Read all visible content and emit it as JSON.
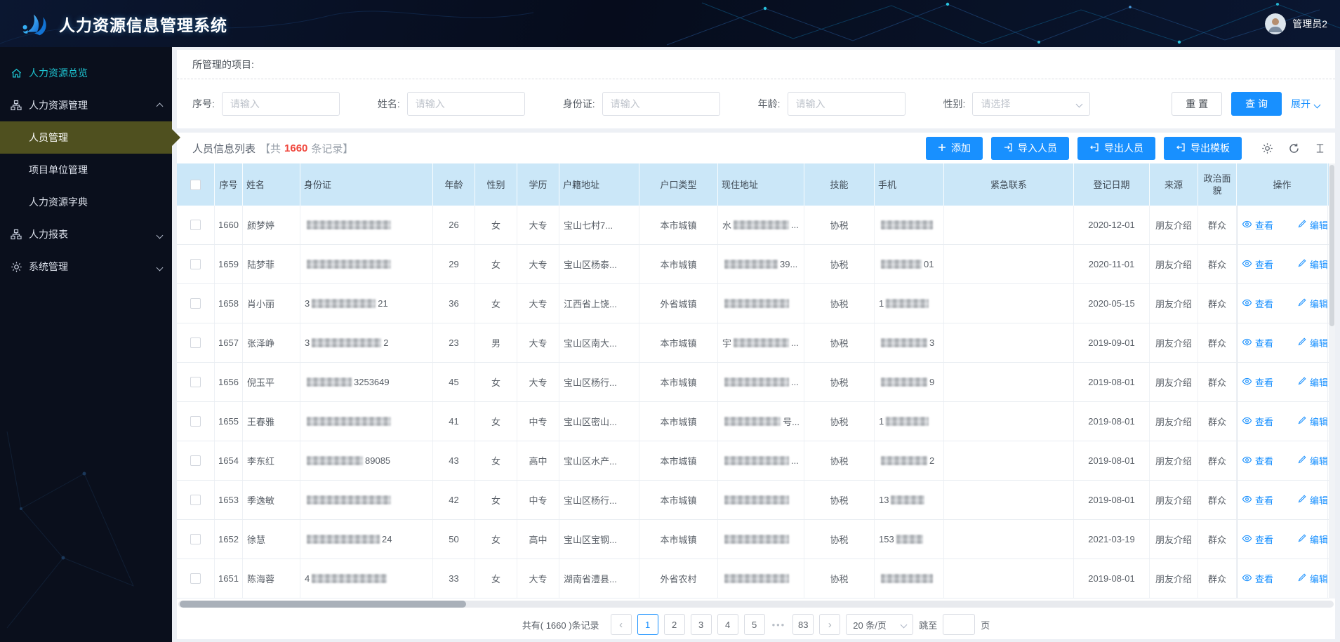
{
  "app": {
    "title": "人力资源信息管理系统",
    "user": "管理员2"
  },
  "colors": {
    "primary": "#1890ff",
    "accent_cyan": "#1ec6d3",
    "count_red": "#f0463c",
    "table_header_bg": "#cbe7f8",
    "active_menu": "#4f501f"
  },
  "sidebar": {
    "items": [
      {
        "id": "hr-overview",
        "label": "人力资源总览",
        "icon": "home",
        "type": "top",
        "accent": true
      },
      {
        "id": "hr-management",
        "label": "人力资源管理",
        "icon": "sitemap",
        "type": "top",
        "expanded": true
      },
      {
        "id": "personnel-management",
        "label": "人员管理",
        "type": "sub",
        "active": true
      },
      {
        "id": "project-unit-management",
        "label": "项目单位管理",
        "type": "sub"
      },
      {
        "id": "hr-dictionary",
        "label": "人力资源字典",
        "type": "sub"
      },
      {
        "id": "hr-reports",
        "label": "人力报表",
        "icon": "sitemap",
        "type": "top",
        "expanded": false
      },
      {
        "id": "system-management",
        "label": "系统管理",
        "icon": "gear",
        "type": "top",
        "expanded": false
      }
    ]
  },
  "projects": {
    "label": "所管理的项目:"
  },
  "filters": {
    "fields": [
      {
        "id": "seq",
        "label": "序号:",
        "placeholder": "请输入",
        "type": "input"
      },
      {
        "id": "name",
        "label": "姓名:",
        "placeholder": "请输入",
        "type": "input"
      },
      {
        "id": "idcard",
        "label": "身份证:",
        "placeholder": "请输入",
        "type": "input"
      },
      {
        "id": "age",
        "label": "年龄:",
        "placeholder": "请输入",
        "type": "input"
      },
      {
        "id": "gender",
        "label": "性别:",
        "placeholder": "请选择",
        "type": "select"
      }
    ],
    "reset": "重 置",
    "search": "查 询",
    "expand": "展开"
  },
  "list": {
    "title": "人员信息列表",
    "count_prefix": "【共",
    "count": "1660",
    "count_suffix": "条记录】",
    "buttons": [
      {
        "id": "add-button",
        "label": "添加",
        "icon": "plus"
      },
      {
        "id": "import-personnel-button",
        "label": "导入人员",
        "icon": "import"
      },
      {
        "id": "export-personnel-button",
        "label": "导出人员",
        "icon": "export"
      },
      {
        "id": "export-template-button",
        "label": "导出模板",
        "icon": "export"
      }
    ],
    "tools": [
      "settings-icon",
      "refresh-icon",
      "density-icon"
    ],
    "row_actions": {
      "view": "查看",
      "edit": "编辑"
    },
    "table": {
      "columns": [
        "序号",
        "姓名",
        "身份证",
        "年龄",
        "性别",
        "学历",
        "户籍地址",
        "户口类型",
        "现住地址",
        "技能",
        "手机",
        "紧急联系",
        "登记日期",
        "来源",
        "政治面貌",
        "操作"
      ],
      "rows": [
        {
          "seq": "1660",
          "name": "颜梦婷",
          "idcard": {
            "masked": true,
            "prefix": "",
            "suffix": ""
          },
          "age": "26",
          "gender": "女",
          "education": "大专",
          "registered_address": "宝山七村7...",
          "hukou_type": "本市城镇",
          "current_address": {
            "masked": true,
            "prefix": "水",
            "suffix": "..."
          },
          "skill": "协税",
          "phone": {
            "masked": true,
            "prefix": "",
            "suffix": ""
          },
          "emergency": "",
          "register_date": "2020-12-01",
          "source": "朋友介绍",
          "political": "群众"
        },
        {
          "seq": "1659",
          "name": "陆梦菲",
          "idcard": {
            "masked": true,
            "prefix": "",
            "suffix": ""
          },
          "age": "29",
          "gender": "女",
          "education": "大专",
          "registered_address": "宝山区杨泰...",
          "hukou_type": "本市城镇",
          "current_address": {
            "masked": true,
            "prefix": "",
            "suffix": "39..."
          },
          "skill": "协税",
          "phone": {
            "masked": true,
            "prefix": "",
            "suffix": "01"
          },
          "emergency": "",
          "register_date": "2020-11-01",
          "source": "朋友介绍",
          "political": "群众"
        },
        {
          "seq": "1658",
          "name": "肖小丽",
          "idcard": {
            "masked": true,
            "prefix": "3",
            "suffix": "21"
          },
          "age": "36",
          "gender": "女",
          "education": "大专",
          "registered_address": "江西省上饶...",
          "hukou_type": "外省城镇",
          "current_address": {
            "masked": true,
            "prefix": "",
            "suffix": ""
          },
          "skill": "协税",
          "phone": {
            "masked": true,
            "prefix": "1",
            "suffix": ""
          },
          "emergency": "",
          "register_date": "2020-05-15",
          "source": "朋友介绍",
          "political": "群众"
        },
        {
          "seq": "1657",
          "name": "张泽峥",
          "idcard": {
            "masked": true,
            "prefix": "3",
            "suffix": "2"
          },
          "age": "23",
          "gender": "男",
          "education": "大专",
          "registered_address": "宝山区南大...",
          "hukou_type": "本市城镇",
          "current_address": {
            "masked": true,
            "prefix": "宇",
            "suffix": "..."
          },
          "skill": "协税",
          "phone": {
            "masked": true,
            "prefix": "",
            "suffix": "3"
          },
          "emergency": "",
          "register_date": "2019-09-01",
          "source": "朋友介绍",
          "political": "群众"
        },
        {
          "seq": "1656",
          "name": "倪玉平",
          "idcard": {
            "masked": true,
            "prefix": "",
            "suffix": "3253649"
          },
          "age": "45",
          "gender": "女",
          "education": "大专",
          "registered_address": "宝山区杨行...",
          "hukou_type": "本市城镇",
          "current_address": {
            "masked": true,
            "prefix": "",
            "suffix": "..."
          },
          "skill": "协税",
          "phone": {
            "masked": true,
            "prefix": "",
            "suffix": "9"
          },
          "emergency": "",
          "register_date": "2019-08-01",
          "source": "朋友介绍",
          "political": "群众"
        },
        {
          "seq": "1655",
          "name": "王春雅",
          "idcard": {
            "masked": true,
            "prefix": "",
            "suffix": ""
          },
          "age": "41",
          "gender": "女",
          "education": "中专",
          "registered_address": "宝山区密山...",
          "hukou_type": "本市城镇",
          "current_address": {
            "masked": true,
            "prefix": "",
            "suffix": "号..."
          },
          "skill": "协税",
          "phone": {
            "masked": true,
            "prefix": "1",
            "suffix": ""
          },
          "emergency": "",
          "register_date": "2019-08-01",
          "source": "朋友介绍",
          "political": "群众"
        },
        {
          "seq": "1654",
          "name": "李东红",
          "idcard": {
            "masked": true,
            "prefix": "",
            "suffix": "89085"
          },
          "age": "43",
          "gender": "女",
          "education": "高中",
          "registered_address": "宝山区水产...",
          "hukou_type": "本市城镇",
          "current_address": {
            "masked": true,
            "prefix": "",
            "suffix": "..."
          },
          "skill": "协税",
          "phone": {
            "masked": true,
            "prefix": "",
            "suffix": "2"
          },
          "emergency": "",
          "register_date": "2019-08-01",
          "source": "朋友介绍",
          "political": "群众"
        },
        {
          "seq": "1653",
          "name": "季逸敏",
          "idcard": {
            "masked": true,
            "prefix": "",
            "suffix": ""
          },
          "age": "42",
          "gender": "女",
          "education": "中专",
          "registered_address": "宝山区杨行...",
          "hukou_type": "本市城镇",
          "current_address": {
            "masked": true,
            "prefix": "",
            "suffix": ""
          },
          "skill": "协税",
          "phone": {
            "masked": true,
            "prefix": "13",
            "suffix": ""
          },
          "emergency": "",
          "register_date": "2019-08-01",
          "source": "朋友介绍",
          "political": "群众"
        },
        {
          "seq": "1652",
          "name": "徐慧",
          "idcard": {
            "masked": true,
            "prefix": "",
            "suffix": "24"
          },
          "age": "50",
          "gender": "女",
          "education": "高中",
          "registered_address": "宝山区宝钢...",
          "hukou_type": "本市城镇",
          "current_address": {
            "masked": true,
            "prefix": "",
            "suffix": ""
          },
          "skill": "协税",
          "phone": {
            "masked": true,
            "prefix": "153",
            "suffix": ""
          },
          "emergency": "",
          "register_date": "2021-03-19",
          "source": "朋友介绍",
          "political": "群众"
        },
        {
          "seq": "1651",
          "name": "陈海蓉",
          "idcard": {
            "masked": true,
            "prefix": "4",
            "suffix": ""
          },
          "age": "33",
          "gender": "女",
          "education": "大专",
          "registered_address": "湖南省澧县...",
          "hukou_type": "外省农村",
          "current_address": {
            "masked": true,
            "prefix": "",
            "suffix": ""
          },
          "skill": "协税",
          "phone": {
            "masked": true,
            "prefix": "",
            "suffix": ""
          },
          "emergency": "",
          "register_date": "2019-08-01",
          "source": "朋友介绍",
          "political": "群众"
        }
      ]
    }
  },
  "pagination": {
    "total": "共有( 1660 )条记录",
    "prev": "‹",
    "next": "›",
    "pages": [
      "1",
      "2",
      "3",
      "4",
      "5"
    ],
    "active_page": "1",
    "ellipsis": "•••",
    "last_page": "83",
    "page_size": "20 条/页",
    "jump_label": "跳至",
    "jump_unit": "页"
  }
}
